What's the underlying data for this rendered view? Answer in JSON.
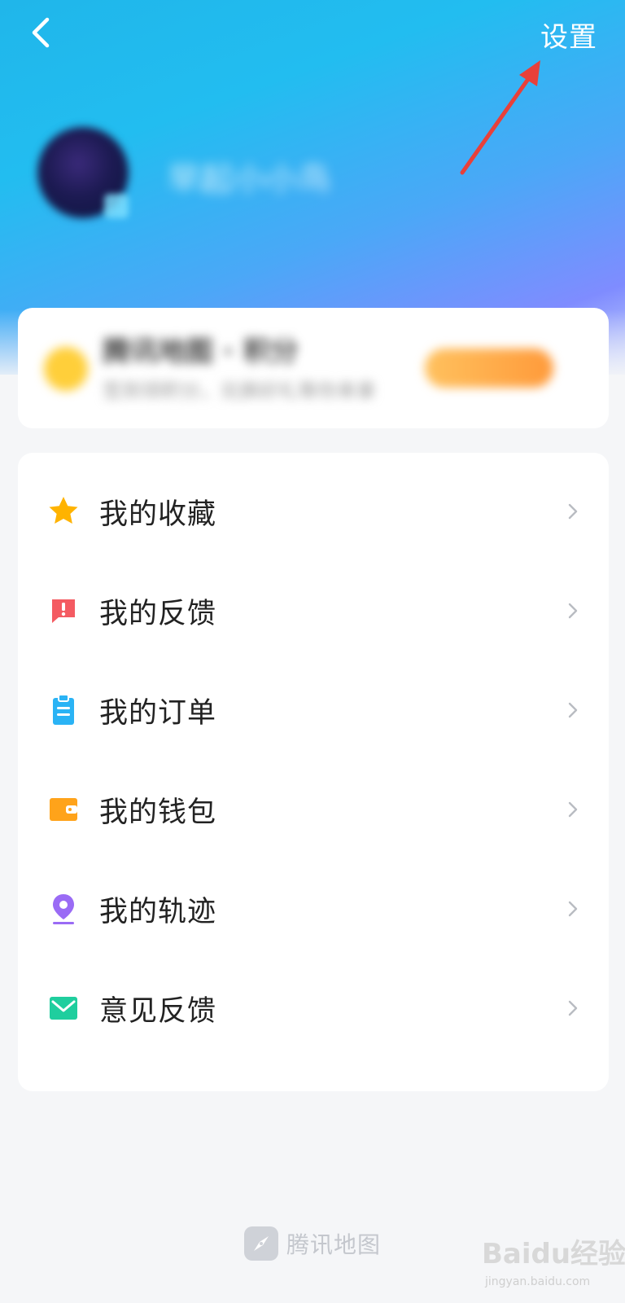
{
  "header": {
    "settings_label": "设置"
  },
  "profile": {
    "username": "早起小小鸟"
  },
  "vip": {
    "title": "腾讯地图 · 积分",
    "subtitle": "签到领积分，兑换好礼等你来拿"
  },
  "menu": {
    "items": [
      {
        "label": "我的收藏",
        "icon": "star-icon",
        "color": "#ffb300"
      },
      {
        "label": "我的反馈",
        "icon": "feedback-alert-icon",
        "color": "#f45b62"
      },
      {
        "label": "我的订单",
        "icon": "clipboard-icon",
        "color": "#2ab3f5"
      },
      {
        "label": "我的钱包",
        "icon": "wallet-icon",
        "color": "#ffa31a"
      },
      {
        "label": "我的轨迹",
        "icon": "location-pin-icon",
        "color": "#9a6bf5"
      },
      {
        "label": "意见反馈",
        "icon": "mail-icon",
        "color": "#1fce9e"
      }
    ]
  },
  "footer": {
    "brand_name": "腾讯地图"
  },
  "watermark": {
    "main": "Baidu经验",
    "sub": "jingyan.baidu.com"
  },
  "colors": {
    "accent_blue": "#22bdf0",
    "annotation_red": "#e8403a",
    "background": "#f5f6f8"
  }
}
